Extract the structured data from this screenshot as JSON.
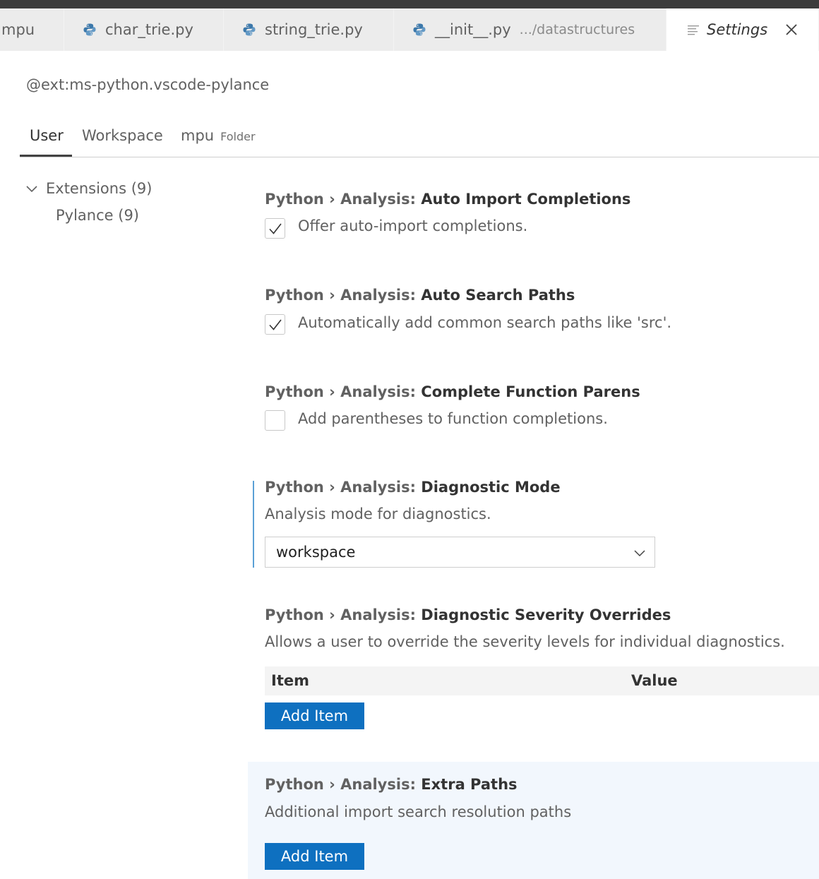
{
  "tabs": [
    {
      "label": "mpu"
    },
    {
      "label": "char_trie.py"
    },
    {
      "label": "string_trie.py"
    },
    {
      "label": "__init__.py",
      "description": ".../datastructures"
    },
    {
      "label": "Settings"
    }
  ],
  "search": {
    "query": "@ext:ms-python.vscode-pylance"
  },
  "scopes": {
    "user": "User",
    "workspace": "Workspace",
    "folder": "mpu",
    "folder_hint": "Folder"
  },
  "toc": {
    "extensions": "Extensions (9)",
    "pylance": "Pylance (9)"
  },
  "settings": [
    {
      "category": "Python › Analysis: ",
      "key": "Auto Import Completions",
      "description": "Offer auto-import completions.",
      "checked": true
    },
    {
      "category": "Python › Analysis: ",
      "key": "Auto Search Paths",
      "description": "Automatically add common search paths like 'src'.",
      "checked": true
    },
    {
      "category": "Python › Analysis: ",
      "key": "Complete Function Parens",
      "description": "Add parentheses to function completions.",
      "checked": false
    },
    {
      "category": "Python › Analysis: ",
      "key": "Diagnostic Mode",
      "description": "Analysis mode for diagnostics.",
      "value": "workspace"
    },
    {
      "category": "Python › Analysis: ",
      "key": "Diagnostic Severity Overrides",
      "description": "Allows a user to override the severity levels for individual diagnostics.",
      "columns": [
        "Item",
        "Value"
      ],
      "button": "Add Item"
    },
    {
      "category": "Python › Analysis: ",
      "key": "Extra Paths",
      "description": "Additional import search resolution paths",
      "button": "Add Item"
    }
  ],
  "colors": {
    "accent": "#0e70c0",
    "focus_bar": "#5aa0d6",
    "hover_row": "#f2f7fd"
  },
  "icons": [
    "python-file-icon",
    "settings-file-icon",
    "close-icon",
    "chevron-down-icon",
    "checkmark-icon"
  ]
}
